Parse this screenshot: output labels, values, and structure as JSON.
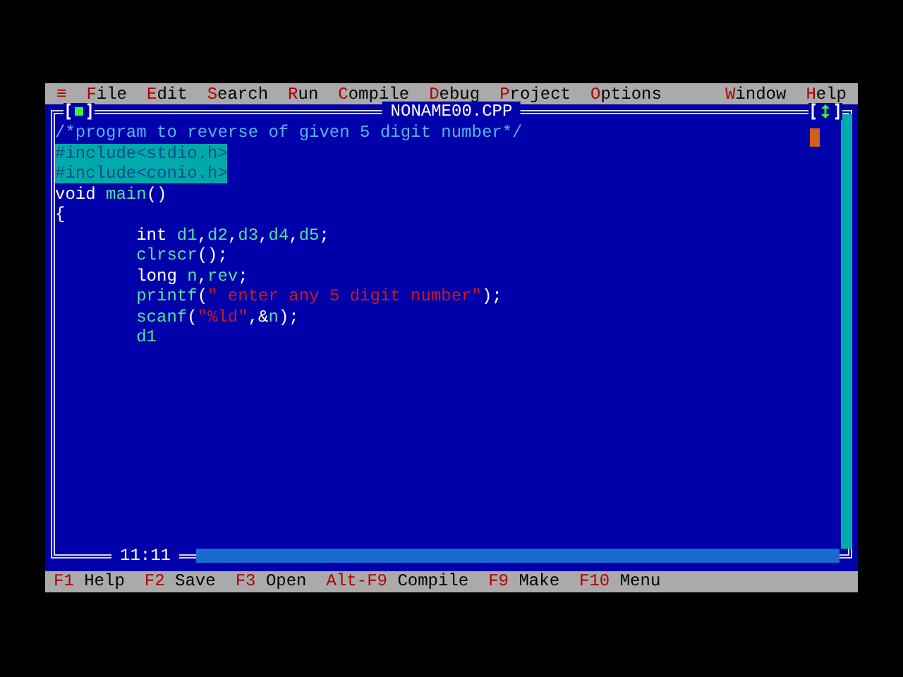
{
  "menu": {
    "left": [
      {
        "label": "≡"
      },
      {
        "label": "File"
      },
      {
        "label": "Edit"
      },
      {
        "label": "Search"
      },
      {
        "label": "Run"
      },
      {
        "label": "Compile"
      },
      {
        "label": "Debug"
      },
      {
        "label": "Project"
      },
      {
        "label": "Options"
      }
    ],
    "right": [
      {
        "label": "Window"
      },
      {
        "label": "Help"
      }
    ]
  },
  "editor": {
    "title": "NONAME00.CPP",
    "cursor_position": "11:11",
    "lines": [
      {
        "selected": false,
        "indented": false,
        "tokens": [
          {
            "kind": "comment",
            "text": "/*program to reverse of given 5 digit number*/"
          }
        ]
      },
      {
        "selected": true,
        "indented": false,
        "tokens": [
          {
            "kind": "preprocessor",
            "text": "#include<stdio.h>"
          }
        ]
      },
      {
        "selected": true,
        "indented": false,
        "tokens": [
          {
            "kind": "preprocessor",
            "text": "#include<conio.h>"
          }
        ]
      },
      {
        "selected": false,
        "indented": false,
        "tokens": [
          {
            "kind": "keyword",
            "text": "void"
          },
          {
            "kind": "identifier",
            "text": " main"
          },
          {
            "kind": "symbol",
            "text": "()"
          }
        ]
      },
      {
        "selected": false,
        "indented": false,
        "tokens": [
          {
            "kind": "symbol",
            "text": "{"
          }
        ]
      },
      {
        "selected": false,
        "indented": true,
        "tokens": [
          {
            "kind": "keyword",
            "text": "int"
          },
          {
            "kind": "identifier",
            "text": " d1"
          },
          {
            "kind": "symbol",
            "text": ","
          },
          {
            "kind": "identifier",
            "text": "d2"
          },
          {
            "kind": "symbol",
            "text": ","
          },
          {
            "kind": "identifier",
            "text": "d3"
          },
          {
            "kind": "symbol",
            "text": ","
          },
          {
            "kind": "identifier",
            "text": "d4"
          },
          {
            "kind": "symbol",
            "text": ","
          },
          {
            "kind": "identifier",
            "text": "d5"
          },
          {
            "kind": "symbol",
            "text": ";"
          }
        ]
      },
      {
        "selected": false,
        "indented": true,
        "tokens": [
          {
            "kind": "identifier",
            "text": "clrscr"
          },
          {
            "kind": "symbol",
            "text": "();"
          }
        ]
      },
      {
        "selected": false,
        "indented": true,
        "tokens": [
          {
            "kind": "keyword",
            "text": "long"
          },
          {
            "kind": "identifier",
            "text": " n"
          },
          {
            "kind": "symbol",
            "text": ","
          },
          {
            "kind": "identifier",
            "text": "rev"
          },
          {
            "kind": "symbol",
            "text": ";"
          }
        ]
      },
      {
        "selected": false,
        "indented": true,
        "tokens": [
          {
            "kind": "identifier",
            "text": "printf"
          },
          {
            "kind": "symbol",
            "text": "("
          },
          {
            "kind": "string",
            "text": "\" enter any 5 digit number\""
          },
          {
            "kind": "symbol",
            "text": ");"
          }
        ]
      },
      {
        "selected": false,
        "indented": true,
        "tokens": [
          {
            "kind": "identifier",
            "text": "scanf"
          },
          {
            "kind": "symbol",
            "text": "("
          },
          {
            "kind": "string",
            "text": "\"%ld\""
          },
          {
            "kind": "symbol",
            "text": ",&"
          },
          {
            "kind": "identifier",
            "text": "n"
          },
          {
            "kind": "symbol",
            "text": ");"
          }
        ]
      },
      {
        "selected": false,
        "indented": true,
        "tokens": [
          {
            "kind": "identifier",
            "text": "d1"
          }
        ]
      }
    ]
  },
  "status_bar": [
    {
      "key": "F1",
      "label": "Help"
    },
    {
      "key": "F2",
      "label": "Save"
    },
    {
      "key": "F3",
      "label": "Open"
    },
    {
      "key": "Alt-F9",
      "label": "Compile"
    },
    {
      "key": "F9",
      "label": "Make"
    },
    {
      "key": "F10",
      "label": "Menu"
    }
  ]
}
